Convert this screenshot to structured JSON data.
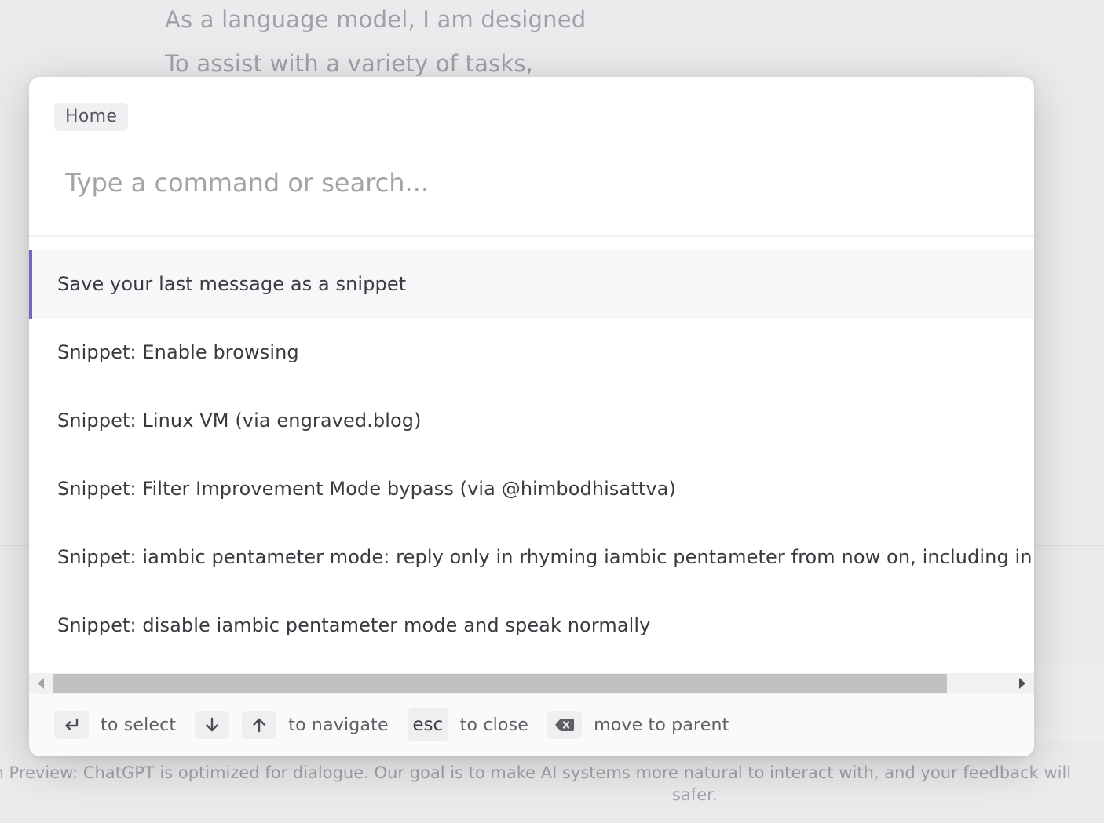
{
  "background": {
    "lines": [
      "As a language model, I am designed",
      "To assist with a variety of tasks,"
    ],
    "footer_line1": "ch Preview: ChatGPT is optimized for dialogue. Our goal is to make AI systems more natural to interact with, and your feedback will",
    "footer_line2": "safer."
  },
  "palette": {
    "breadcrumb": {
      "label": "Home"
    },
    "search": {
      "placeholder": "Type a command or search..."
    },
    "results": [
      {
        "label": "Save your last message as a snippet",
        "active": true
      },
      {
        "label": "Snippet: Enable browsing",
        "active": false
      },
      {
        "label": "Snippet: Linux VM (via engraved.blog)",
        "active": false
      },
      {
        "label": "Snippet: Filter Improvement Mode bypass (via @himbodhisattva)",
        "active": false
      },
      {
        "label": "Snippet: iambic pentameter mode: reply only in rhyming iambic pentameter from now on, including in your",
        "active": false
      },
      {
        "label": "Snippet: disable iambic pentameter mode and speak normally",
        "active": false
      }
    ],
    "hints": {
      "select_icon": "enter-icon",
      "select_label": "to select",
      "down_icon": "arrow-down-icon",
      "up_icon": "arrow-up-icon",
      "navigate_label": "to navigate",
      "esc_key": "esc",
      "close_label": "to close",
      "backspace_icon": "backspace-icon",
      "parent_label": "move to parent"
    }
  },
  "colors": {
    "accent": "#6c63d6",
    "overlay_background": "#ebebed",
    "modal_background": "#ffffff"
  }
}
